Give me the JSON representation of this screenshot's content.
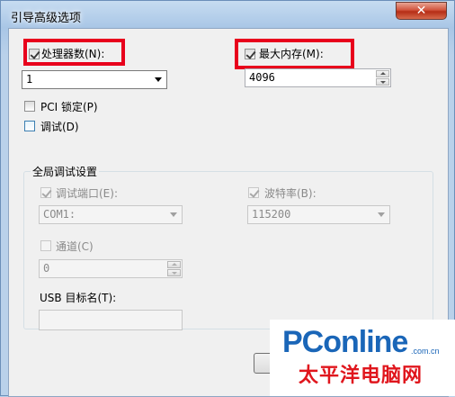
{
  "window": {
    "title": "引导高级选项",
    "close_glyph": "✕"
  },
  "processors": {
    "checkbox_label": "处理器数(N):",
    "checked": true,
    "selected_value": "1"
  },
  "max_memory": {
    "checkbox_label": "最大内存(M):",
    "checked": true,
    "value": "4096"
  },
  "pci_lock": {
    "label": "PCI 锁定(P)",
    "checked": false
  },
  "debug": {
    "label": "调试(D)",
    "checked": false
  },
  "global_debug": {
    "group_title": "全局调试设置",
    "debug_port": {
      "label": "调试端口(E):",
      "checked": true,
      "selected_value": "COM1:"
    },
    "baud_rate": {
      "label": "波特率(B):",
      "checked": true,
      "selected_value": "115200"
    },
    "channel": {
      "label": "通道(C)",
      "checked": false,
      "value": "0"
    },
    "usb_target": {
      "label": "USB 目标名(T):",
      "value": ""
    }
  },
  "watermark": {
    "brand_latin": "PConline",
    "brand_suffix": ".com.cn",
    "brand_cn": "太平洋电脑网"
  },
  "colors": {
    "highlight": "#e8001c",
    "title_gradient_top": "#c7dcf1",
    "close_button": "#c8432a",
    "watermark_blue": "#1a66b8",
    "watermark_red": "#e0161d"
  }
}
